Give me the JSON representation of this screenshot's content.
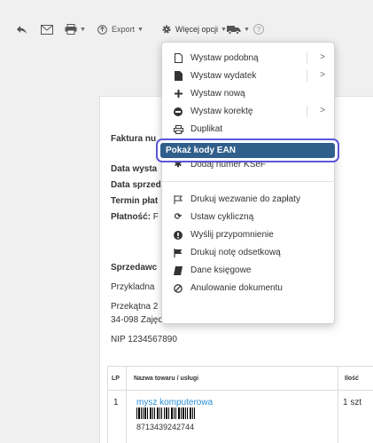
{
  "toolbar": {
    "export_label": "Export",
    "more_options_label": "Więcej opcji",
    "help_label": "?"
  },
  "invoice": {
    "title_partial": "Faktura nu",
    "issue_date_label": "Data wysta",
    "sale_date_label": "Data sprzed",
    "payment_term_label": "Termin płat",
    "payment_label": "Płatność:",
    "payment_value_partial": "F",
    "seller_heading_partial": "Sprzedawc",
    "seller_name_partial": "Przykladna",
    "seller_street_partial": "Przekątna 2",
    "seller_city": "34-098 Zajęcza",
    "seller_nip": "NIP 1234567890",
    "table": {
      "col_lp": "LP",
      "col_name": "Nazwa towaru / usługi",
      "col_qty": "Ilość",
      "rows": [
        {
          "lp": "1",
          "name": "mysz komputerowa",
          "ean": "8713439242744",
          "qty": "1 szt"
        }
      ]
    }
  },
  "menu": {
    "items": [
      {
        "label": "Wystaw podobną",
        "icon": "document-icon",
        "submenu": ">"
      },
      {
        "label": "Wystaw wydatek",
        "icon": "filled-document-icon",
        "submenu": ">"
      },
      {
        "label": "Wystaw nową",
        "icon": "plus-icon"
      },
      {
        "label": "Wystaw korektę",
        "icon": "minus-circle-icon",
        "submenu": ">"
      },
      {
        "label": "Duplikat",
        "icon": "print-icon"
      },
      {
        "label": "Pokaż kody EAN",
        "icon": ""
      },
      {
        "label": "Dodaj numer KSeF",
        "icon": "asterisk-icon"
      },
      {
        "label": "Drukuj wezwanie do zapłaty",
        "icon": "flag-outline-icon"
      },
      {
        "label": "Ustaw cykliczną",
        "icon": "refresh-icon"
      },
      {
        "label": "Wyślij przypomnienie",
        "icon": "exclamation-circle-icon"
      },
      {
        "label": "Drukuj notę odsetkową",
        "icon": "flag-icon"
      },
      {
        "label": "Dane księgowe",
        "icon": "book-icon"
      },
      {
        "label": "Anulowanie dokumentu",
        "icon": "ban-icon"
      }
    ]
  },
  "colors": {
    "highlight_bg": "#2f5f8a",
    "highlight_ring": "#5a56d6",
    "link": "#2a8fd6"
  }
}
